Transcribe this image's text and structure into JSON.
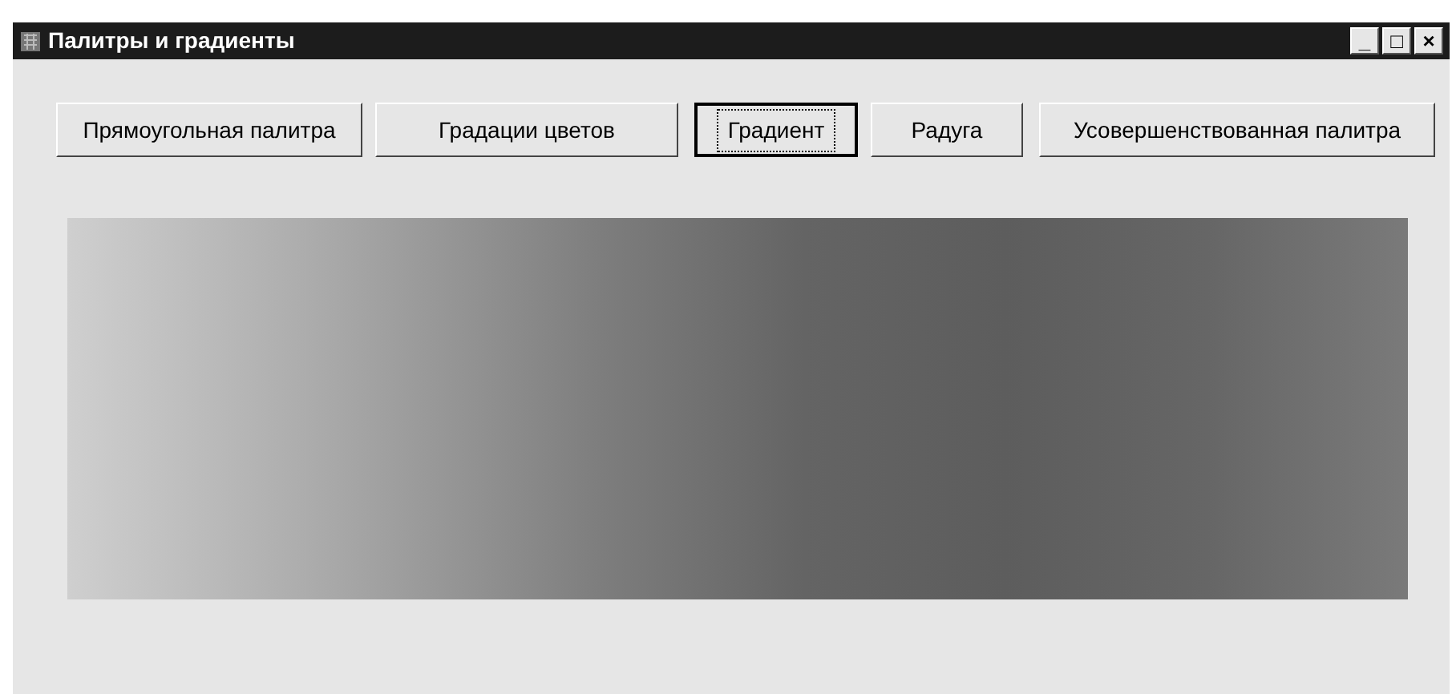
{
  "window": {
    "title": "Палитры и градиенты",
    "controls": [
      "_",
      "□",
      "×"
    ]
  },
  "buttons": [
    {
      "label": "Прямоугольная палитра",
      "selected": false
    },
    {
      "label": "Градации цветов",
      "selected": false
    },
    {
      "label": "Градиент",
      "selected": true
    },
    {
      "label": "Радуга",
      "selected": false
    },
    {
      "label": "Усовершенствованная палитра",
      "selected": false
    }
  ]
}
